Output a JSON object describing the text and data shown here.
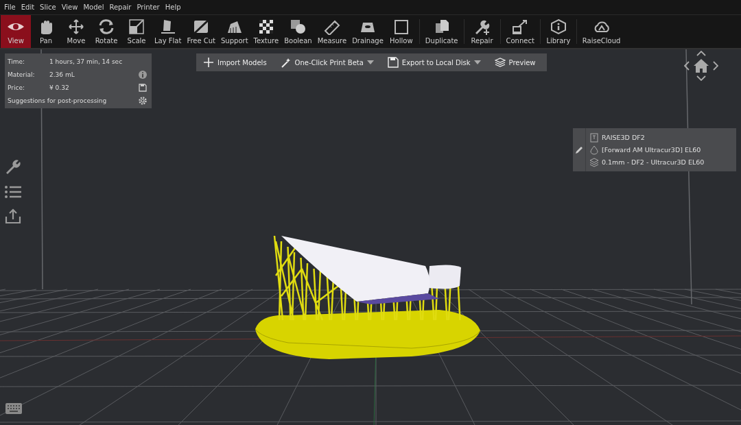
{
  "menu": [
    "File",
    "Edit",
    "Slice",
    "View",
    "Model",
    "Repair",
    "Printer",
    "Help"
  ],
  "toolbar": {
    "groups": [
      [
        {
          "label": "View",
          "selected": true
        },
        {
          "label": "Pan",
          "selected": false
        },
        {
          "label": "Move",
          "selected": false
        },
        {
          "label": "Rotate",
          "selected": false
        },
        {
          "label": "Scale",
          "selected": false
        },
        {
          "label": "Lay Flat",
          "selected": false
        },
        {
          "label": "Free Cut",
          "selected": false
        },
        {
          "label": "Support",
          "selected": false
        },
        {
          "label": "Texture",
          "selected": false
        },
        {
          "label": "Boolean",
          "selected": false
        },
        {
          "label": "Measure",
          "selected": false
        },
        {
          "label": "Drainage",
          "selected": false
        },
        {
          "label": "Hollow",
          "selected": false
        }
      ],
      [
        {
          "label": "Duplicate",
          "selected": false
        }
      ],
      [
        {
          "label": "Repair",
          "selected": false
        }
      ],
      [
        {
          "label": "Connect",
          "selected": false
        }
      ],
      [
        {
          "label": "Library",
          "selected": false
        }
      ],
      [
        {
          "label": "RaiseCloud",
          "selected": false
        }
      ]
    ]
  },
  "estimate": {
    "rows": [
      {
        "label": "Time:",
        "value": "1 hours, 37 min, 14 sec"
      },
      {
        "label": "Material:",
        "value": "2.36 mL"
      },
      {
        "label": "Price:",
        "value": "¥ 0.32"
      }
    ],
    "suggestion": "Suggestions for post-processing"
  },
  "actions": [
    {
      "label": "Import Models",
      "has_menu": false
    },
    {
      "label": "One-Click Print Beta",
      "has_menu": true
    },
    {
      "label": "Export to Local Disk",
      "has_menu": true
    },
    {
      "label": "Preview",
      "has_menu": false
    }
  ],
  "printer_panel": {
    "printer": "RAISE3D DF2",
    "material": "[Forward AM Ultracur3D] EL60",
    "profile": "0.1mm - DF2 - Ultracur3D EL60"
  }
}
